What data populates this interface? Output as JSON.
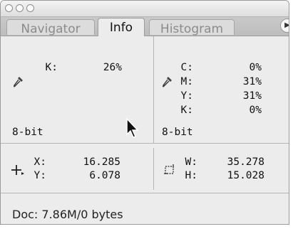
{
  "window": {
    "traffic_lights": [
      "close",
      "minimize",
      "zoom"
    ]
  },
  "tabs": [
    {
      "label": "Navigator",
      "active": false
    },
    {
      "label": "Info",
      "active": true
    },
    {
      "label": "Histogram",
      "active": false
    }
  ],
  "left_sample": {
    "k_label": "K:",
    "k_value": "26%",
    "bit_depth": "8-bit",
    "icon": "eyedropper-icon"
  },
  "right_sample": {
    "c_label": "C:",
    "c_value": "0%",
    "m_label": "M:",
    "m_value": "31%",
    "y_label": "Y:",
    "y_value": "31%",
    "k_label": "K:",
    "k_value": "0%",
    "bit_depth": "8-bit",
    "icon": "eyedropper-icon"
  },
  "position": {
    "x_label": "X:",
    "x_value": "16.285",
    "y_label": "Y:",
    "y_value": "6.078",
    "icon": "crosshair-icon"
  },
  "size": {
    "w_label": "W:",
    "w_value": "35.278",
    "h_label": "H:",
    "h_value": "15.028",
    "icon": "selection-size-icon"
  },
  "footer": {
    "doc_info": "Doc: 7.86M/0 bytes"
  },
  "colors": {
    "panel_bg": "#ececec",
    "tab_inactive_text": "#8b8b8b"
  }
}
